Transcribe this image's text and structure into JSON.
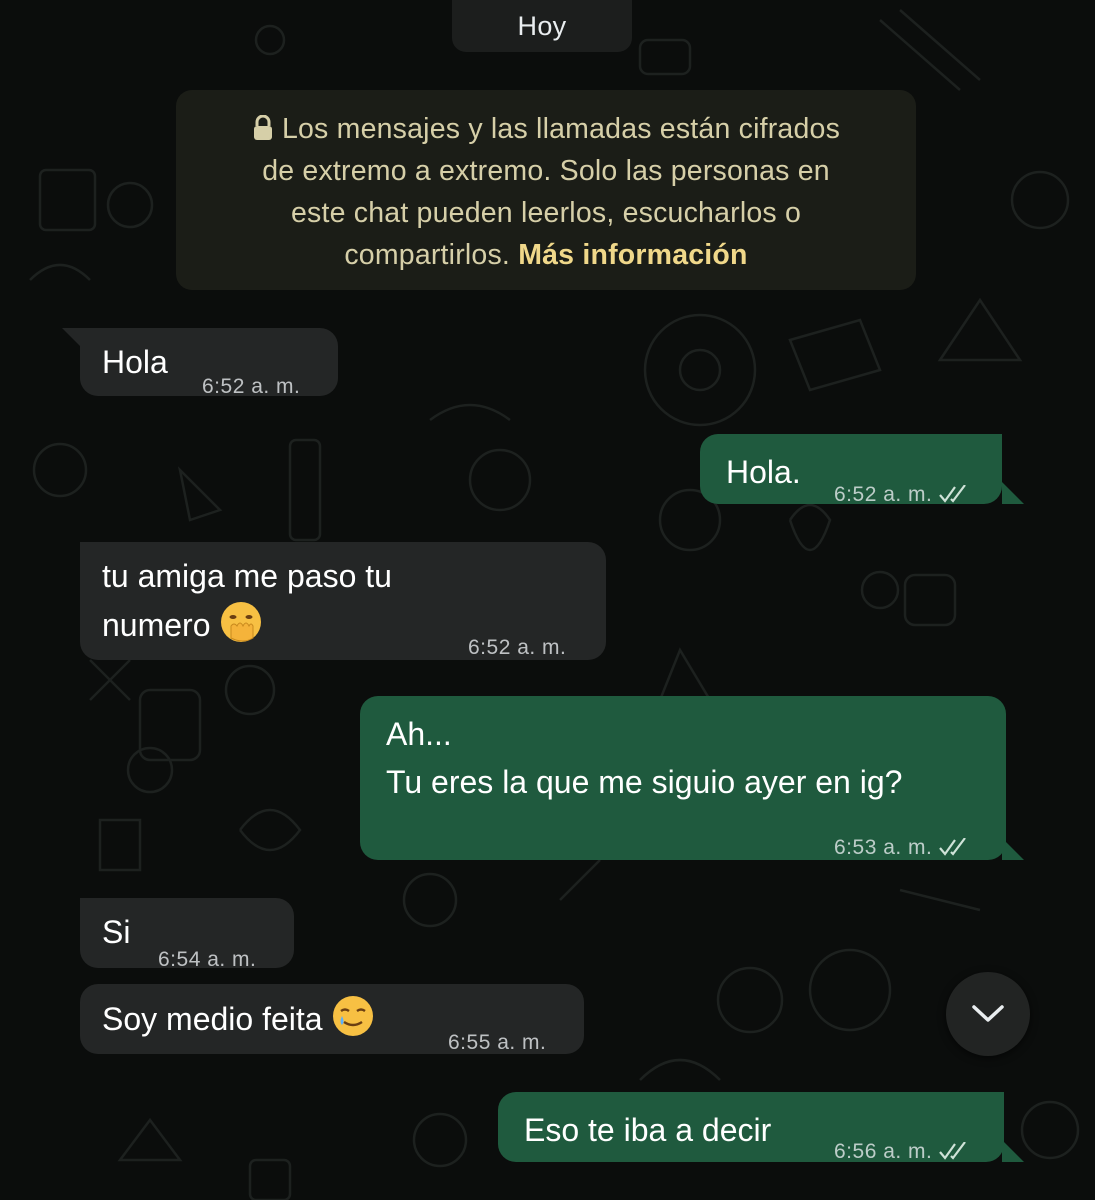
{
  "date_chip": "Hoy",
  "encryption_notice": {
    "lines": [
      "Los mensajes y las llamadas están cifrados",
      "de extremo a extremo. Solo las personas en",
      "este chat pueden leerlos, escucharlos o"
    ],
    "last_line": "compartirlos.",
    "link": "Más información",
    "icon": "lock-icon"
  },
  "messages": [
    {
      "direction": "in",
      "text": "Hola",
      "time": "6:52 a. m."
    },
    {
      "direction": "out",
      "text": "Hola.",
      "time": "6:52 a. m.",
      "status": "read"
    },
    {
      "direction": "in",
      "lines": [
        "tu amiga me paso tu",
        "numero"
      ],
      "emoji": "hand-over-mouth-emoji",
      "time": "6:52 a. m."
    },
    {
      "direction": "out",
      "lines": [
        "Ah...",
        "Tu eres la que me siguio ayer en ig?"
      ],
      "time": "6:53 a. m.",
      "status": "read"
    },
    {
      "direction": "in",
      "text": "Si",
      "time": "6:54 a. m."
    },
    {
      "direction": "in",
      "text": "Soy medio feita",
      "emoji": "smiling-face-with-tear-emoji",
      "time": "6:55 a. m."
    },
    {
      "direction": "out",
      "text": "Eso te iba a decir",
      "time": "6:56 a. m.",
      "status": "read"
    }
  ],
  "scroll_button_icon": "chevron-down-icon",
  "colors": {
    "background": "#0b0d0c",
    "incoming_bubble": "#242626",
    "outgoing_bubble": "#1f5a3e",
    "encryption_box": "#1b1d17",
    "encryption_link": "#f0d88a"
  }
}
